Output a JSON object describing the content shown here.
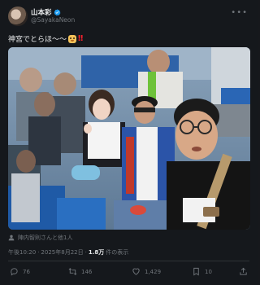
{
  "author": {
    "display_name": "山本彩",
    "handle": "@SayakaNeon",
    "verified": true
  },
  "tweet": {
    "text": "神宮でとらほ〜〜",
    "emoji": "tiger-face",
    "emphasis": "‼"
  },
  "tagged": {
    "label": "陣内智則さんと他1人"
  },
  "meta": {
    "time": "午後10:20",
    "separator": "·",
    "date": "2025年8月22日",
    "views_count": "1.8万",
    "views_label": "件の表示"
  },
  "actions": {
    "reply_count": "76",
    "retweet_count": "146",
    "like_count": "1,429",
    "bookmark_count": "10"
  },
  "colors": {
    "background": "#16181c",
    "text": "#e7e9ea",
    "muted": "#71767b",
    "verified": "#1d9bf0",
    "accent_red": "#f4212e"
  }
}
